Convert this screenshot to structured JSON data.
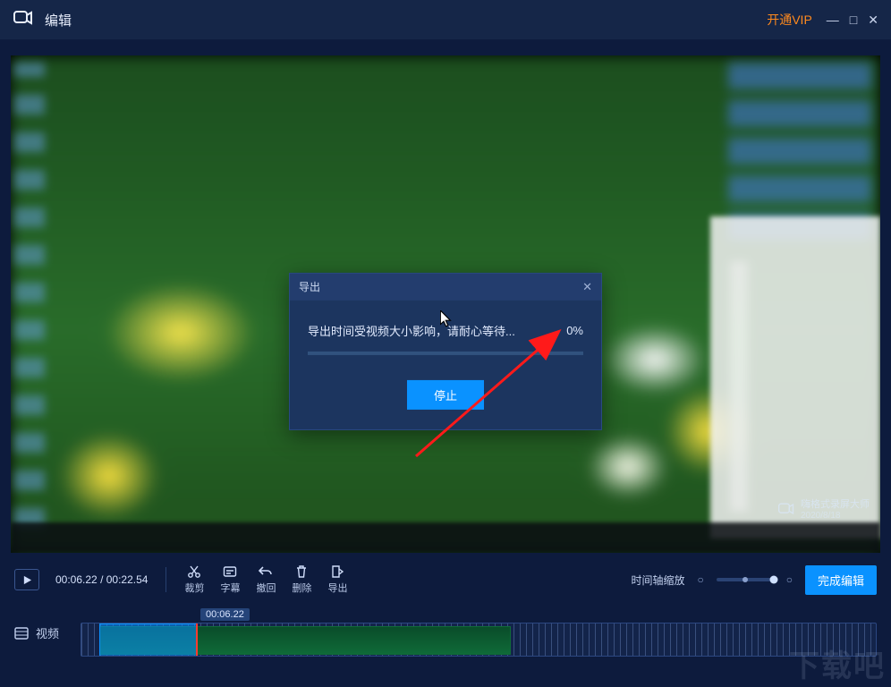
{
  "titlebar": {
    "title": "编辑",
    "vip": "开通VIP"
  },
  "win_controls": {
    "min": "—",
    "max": "□",
    "close": "✕"
  },
  "preview_watermark": {
    "brand": "嗨格式录屏大师",
    "meta": "2020/8/18"
  },
  "dialog": {
    "title": "导出",
    "message": "导出时间受视频大小影响，请耐心等待...",
    "percent": "0%",
    "stop": "停止"
  },
  "toolbar": {
    "time_current": "00:06.22",
    "time_total": "00:22.54",
    "items": {
      "crop": "裁剪",
      "subtitle": "字幕",
      "undo": "撤回",
      "delete": "删除",
      "export": "导出"
    },
    "zoom_label": "时间轴缩放",
    "finish": "完成编辑"
  },
  "timeline": {
    "track_label": "视频",
    "time_tag": "00:06.22"
  },
  "icons": {
    "close": "✕"
  },
  "site_watermark": "下载吧"
}
